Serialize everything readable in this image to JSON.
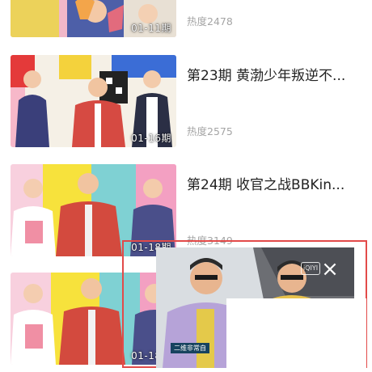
{
  "episodes": [
    {
      "title": "",
      "date": "01-11期",
      "heat": "热度2478"
    },
    {
      "title": "第23期 黄渤少年叛逆不...",
      "date": "01-16期",
      "heat": "热度2575"
    },
    {
      "title": "第24期 收官之战BBKin...",
      "date": "01-18期",
      "heat": "热度3149"
    },
    {
      "title": "",
      "date": "01-18期",
      "heat": ""
    }
  ],
  "mini_player": {
    "logo": "iQIYI",
    "caption": "二维非常自",
    "close_label": "×"
  }
}
